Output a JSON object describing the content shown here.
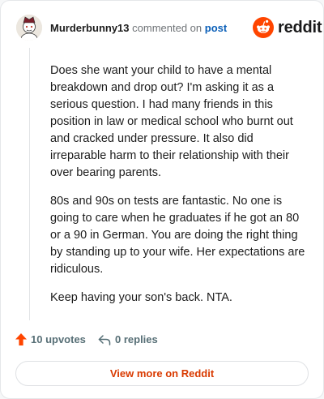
{
  "header": {
    "username": "Murderbunny13",
    "commented_text": "commented on",
    "post_link": "post",
    "brand_name": "reddit"
  },
  "comment": {
    "paragraphs": [
      "Does she want your child to have a mental breakdown and drop out? I'm asking it as a serious question. I had many friends in this position in law or medical school who burnt out and cracked under pressure. It also did irreparable harm to their relationship with their over bearing parents.",
      "80s and 90s on tests are fantastic. No one is going to care when he graduates if he got an 80 or a 90 in German. You are doing the right thing by standing up to your wife. Her expectations are ridiculous.",
      "Keep having your son's back. NTA."
    ]
  },
  "actions": {
    "upvotes_label": "10 upvotes",
    "replies_label": "0 replies"
  },
  "footer": {
    "view_more_label": "View more on Reddit"
  },
  "colors": {
    "brand_orange": "#ff4500",
    "link_blue": "#0a5fb8",
    "view_more_text": "#d93a00",
    "action_gray": "#576f76"
  },
  "icons": {
    "avatar": "snoo-avatar-icon",
    "brand": "reddit-logo-icon",
    "upvote": "upvote-arrow-icon",
    "reply": "reply-arrow-icon"
  }
}
